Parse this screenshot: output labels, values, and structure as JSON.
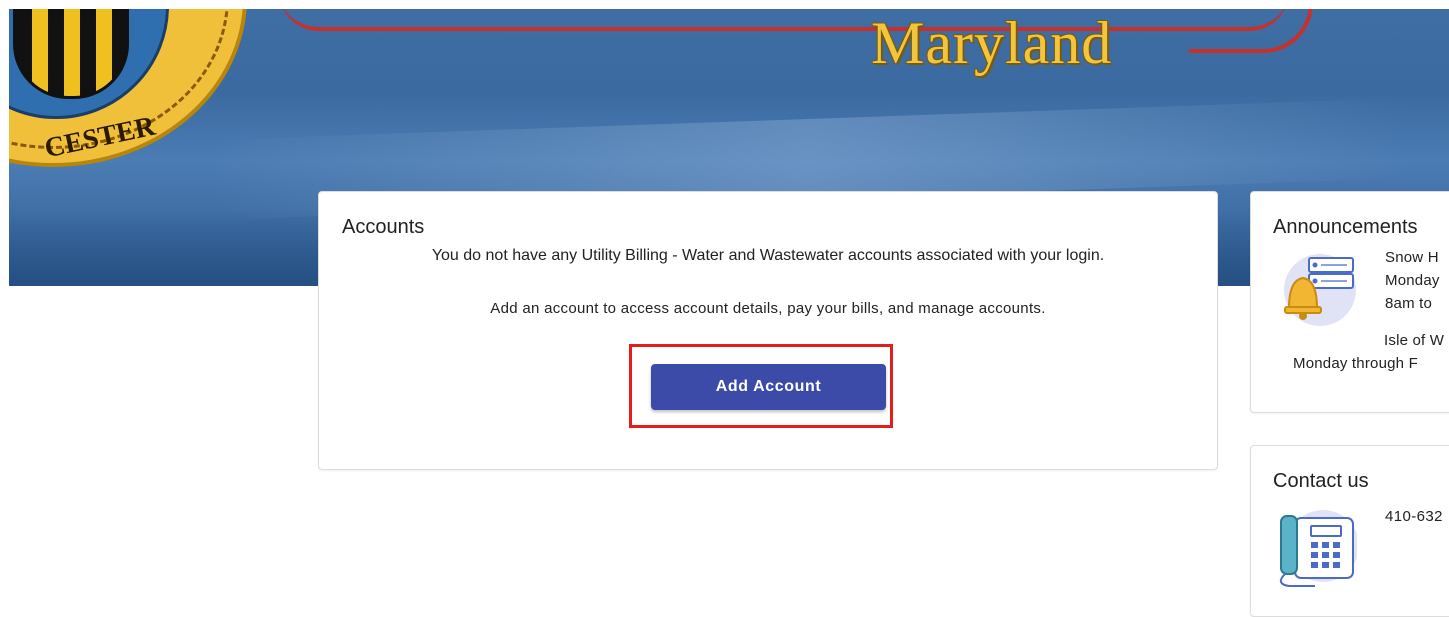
{
  "banner": {
    "region_text": "Maryland",
    "seal_text": "CESTER",
    "colors": {
      "sky": "#3e6ea4",
      "lettering": "#f2c53d",
      "script_red": "#c8302c"
    }
  },
  "accounts": {
    "title": "Accounts",
    "message_line1": "You do not have any Utility Billing - Water and Wastewater accounts associated with your login.",
    "message_line2": "Add an account to access account details, pay your bills, and manage accounts.",
    "add_button_label": "Add Account",
    "button_color": "#3c4ba8",
    "highlight_color": "#e31c1c"
  },
  "announcements": {
    "title": "Announcements",
    "icon": "bell-notification-icon",
    "lines": [
      "Snow H",
      "Monday",
      "8am to",
      "Isle of W",
      "Monday through F"
    ]
  },
  "contact": {
    "title": "Contact us",
    "icon": "telephone-icon",
    "phone": "410-632"
  }
}
